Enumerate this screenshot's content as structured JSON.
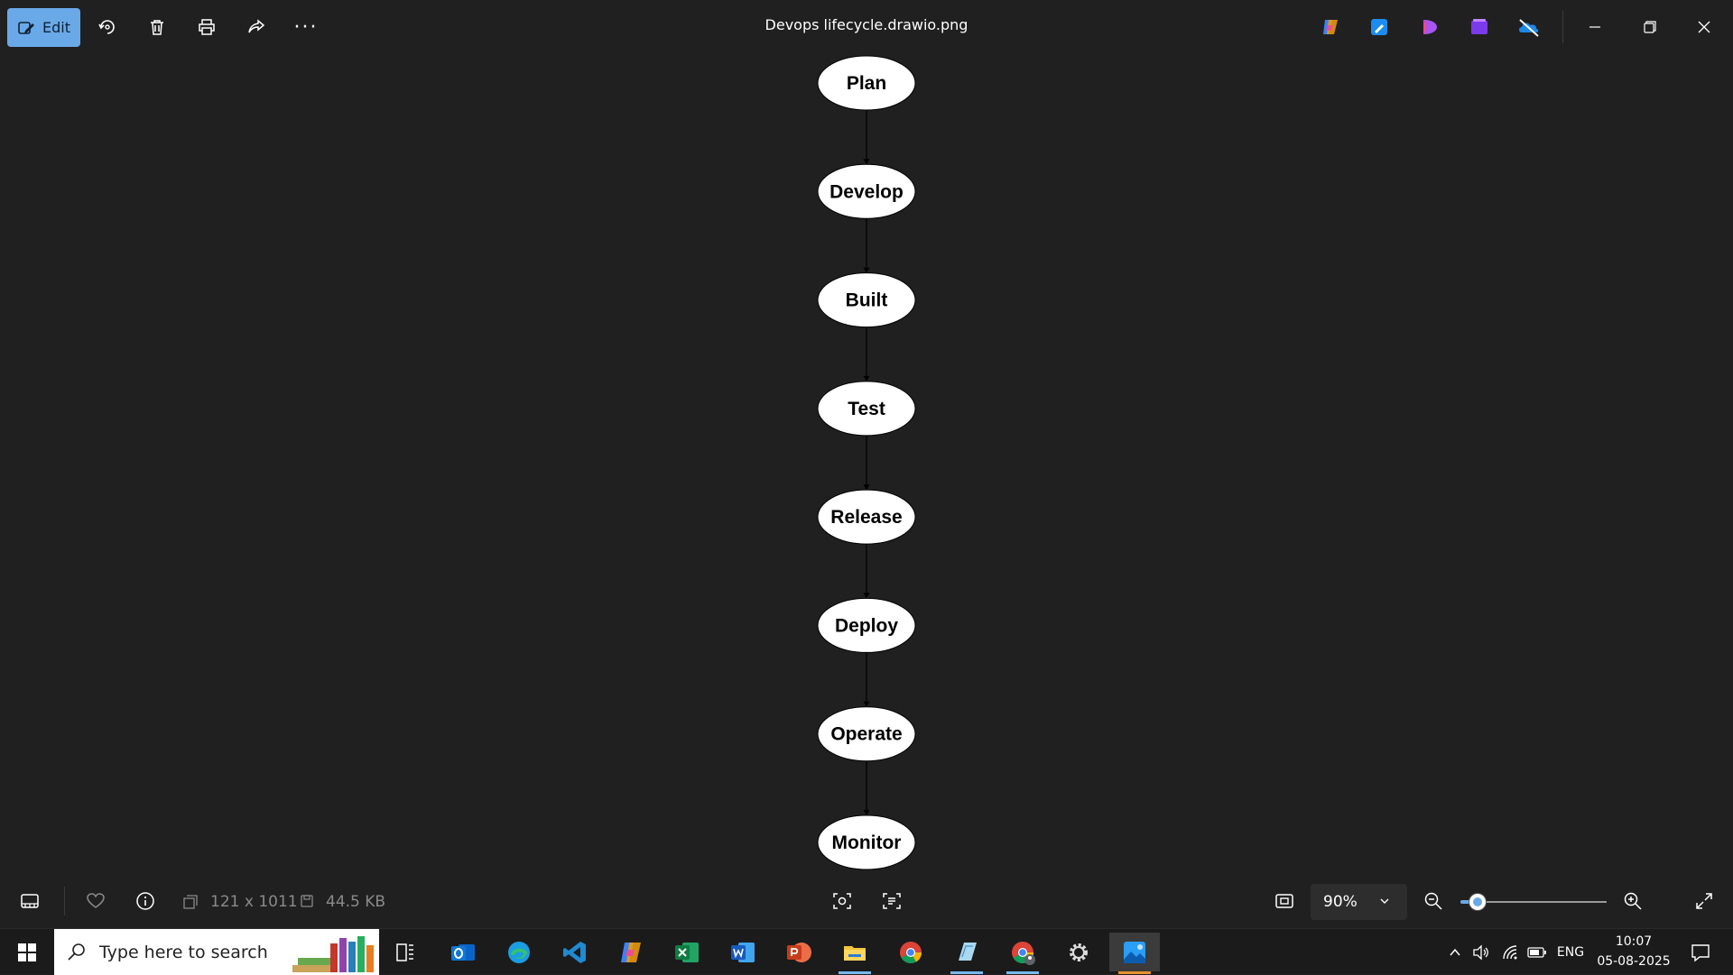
{
  "toolbar": {
    "edit_label": "Edit",
    "more_label": "···"
  },
  "window": {
    "title": "Devops lifecycle.drawio.png"
  },
  "diagram": {
    "nodes": [
      "Plan",
      "Develop",
      "Built",
      "Test",
      "Release",
      "Deploy",
      "Operate",
      "Monitor"
    ]
  },
  "statusbar": {
    "dimensions": "121 x 1011",
    "file_size": "44.5 KB",
    "zoom": "90%",
    "zoom_level": 0.12
  },
  "taskbar": {
    "search_placeholder": "Type here to search",
    "language": "ENG",
    "time": "10:07",
    "date": "05-08-2025"
  },
  "colors": {
    "accent": "#6aa9e8",
    "background": "#202020",
    "node_fill": "#ffffff",
    "node_text": "#000000"
  }
}
